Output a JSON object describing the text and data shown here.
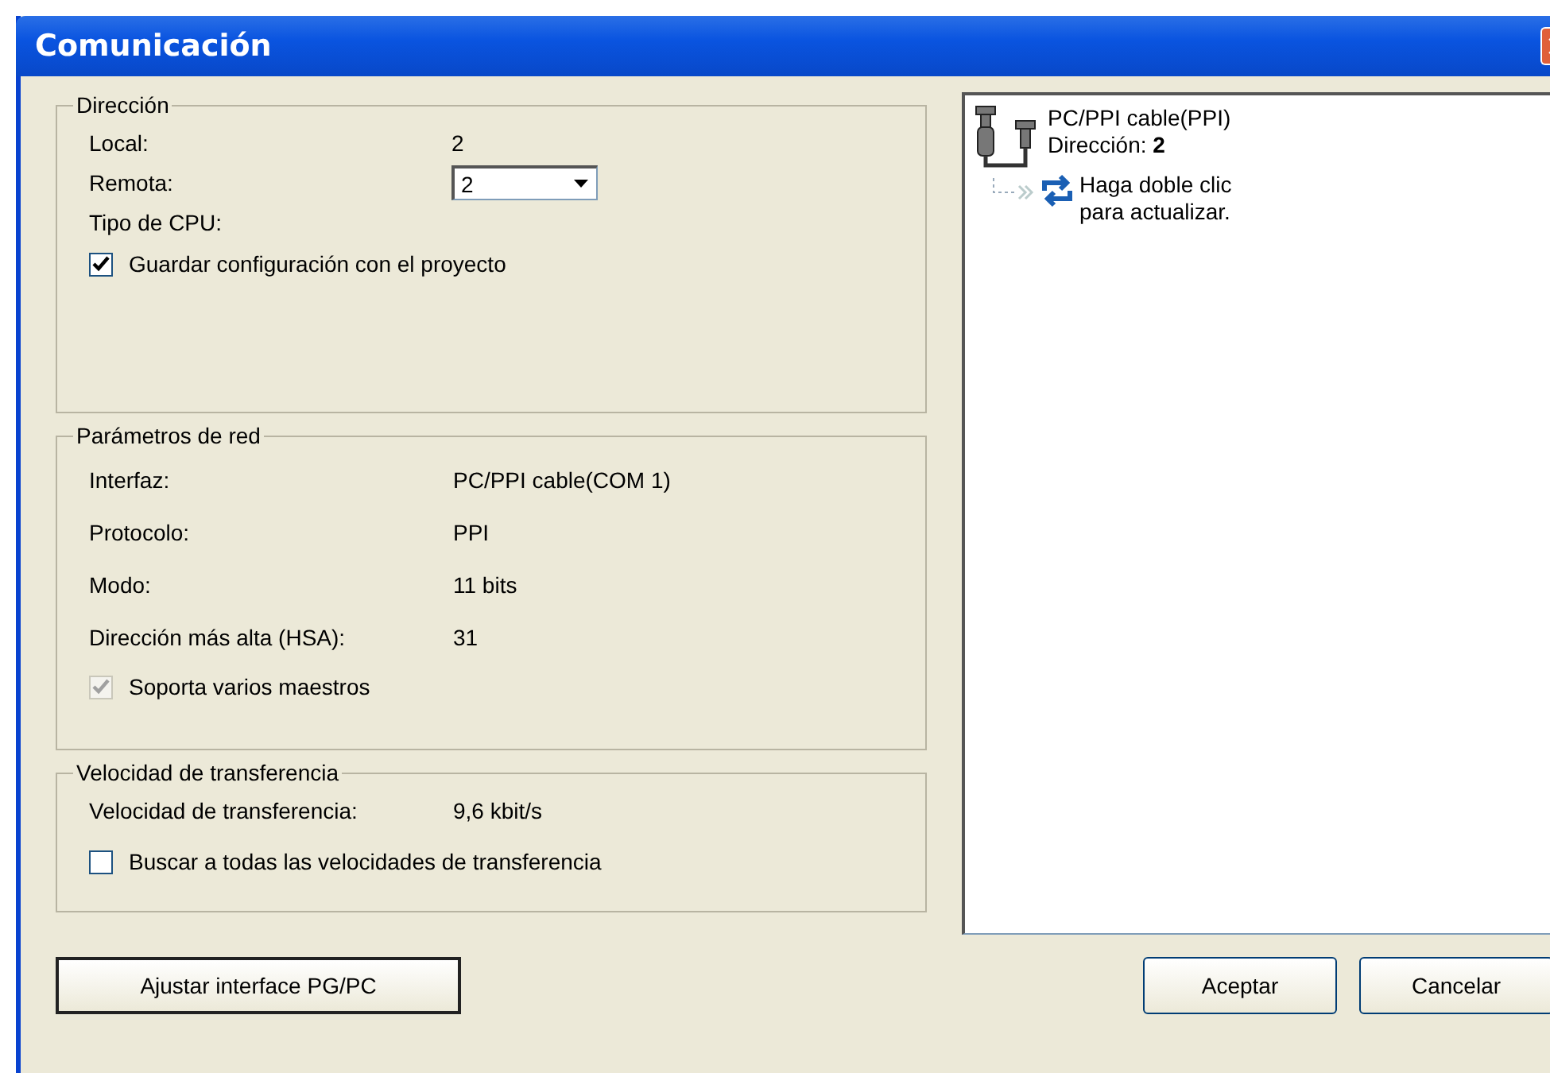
{
  "window": {
    "title": "Comunicación"
  },
  "groups": [
    {
      "title": "Dirección",
      "rows": [
        {
          "kind": "text",
          "label": "Local:",
          "value": "2"
        },
        {
          "kind": "dropdown",
          "label": "Remota:",
          "value": "2"
        },
        {
          "kind": "text",
          "label": "Tipo de CPU:"
        }
      ],
      "checkbox": {
        "label": "Guardar configuración con el proyecto",
        "checked": true,
        "disabled": false
      }
    },
    {
      "title": "Parámetros de red",
      "rows": [
        {
          "kind": "text",
          "label": "Interfaz:",
          "value": "PC/PPI cable(COM 1)"
        },
        {
          "kind": "text",
          "label": "Protocolo:",
          "value": "PPI"
        },
        {
          "kind": "text",
          "label": "Modo:",
          "value": "11 bits"
        },
        {
          "kind": "text",
          "label": "Dirección más alta (HSA):",
          "value": "31"
        }
      ],
      "checkbox": {
        "label": "Soporta varios maestros",
        "checked": true,
        "disabled": true
      }
    },
    {
      "title": "Velocidad de transferencia",
      "rows": [
        {
          "kind": "text",
          "label": "Velocidad de transferencia:",
          "value": "9,6 kbit/s"
        }
      ],
      "checkbox": {
        "label": "Buscar a todas las velocidades de transferencia",
        "checked": false,
        "disabled": false
      }
    }
  ],
  "tree": {
    "name": "PC/PPI cable(PPI)",
    "address": "Dirección: **2**",
    "children": [
      {
        "label": "Haga doble clic para actualizar."
      }
    ]
  },
  "setup_button": "Ajustar interface PG/PC",
  "buttons": [
    "Aceptar",
    "Cancelar"
  ]
}
